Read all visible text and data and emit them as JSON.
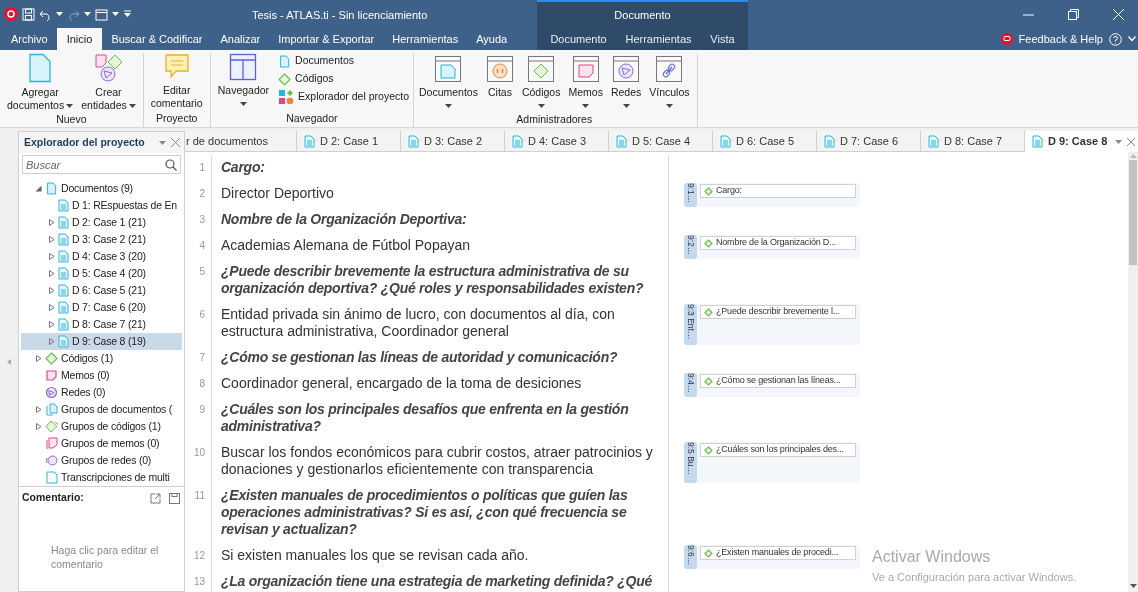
{
  "window": {
    "title": "Tesis - ATLAS.ti - Sin licenciamiento",
    "context_title": "Documento"
  },
  "menu_tabs": [
    {
      "label": "Archivo",
      "selected": false,
      "contextual": false
    },
    {
      "label": "Inicio",
      "selected": true,
      "contextual": false
    },
    {
      "label": "Buscar & Codificar",
      "selected": false,
      "contextual": false
    },
    {
      "label": "Analizar",
      "selected": false,
      "contextual": false
    },
    {
      "label": "Importar & Exportar",
      "selected": false,
      "contextual": false
    },
    {
      "label": "Herramientas",
      "selected": false,
      "contextual": false
    },
    {
      "label": "Ayuda",
      "selected": false,
      "contextual": false
    },
    {
      "label": "Documento",
      "selected": false,
      "contextual": true
    },
    {
      "label": "Herramientas",
      "selected": false,
      "contextual": true
    },
    {
      "label": "Vista",
      "selected": false,
      "contextual": true
    }
  ],
  "feedback": {
    "label": "Feedback & Help"
  },
  "ribbon": [
    {
      "group": "Nuevo",
      "buttons": [
        {
          "kind": "add-doc",
          "label": "Agregar",
          "label2": "documentos",
          "dropdown": true
        },
        {
          "kind": "create",
          "label": "Crear",
          "label2": "entidades",
          "dropdown": true
        }
      ]
    },
    {
      "group": "Proyecto",
      "buttons": [
        {
          "kind": "comment",
          "label": "Editar",
          "label2": "comentario",
          "dropdown": false
        }
      ]
    },
    {
      "group": "Navegador",
      "buttons": [
        {
          "kind": "navigator",
          "label": "Navegador",
          "dropdown": true
        }
      ],
      "small": [
        {
          "kind": "doc",
          "label": "Documentos"
        },
        {
          "kind": "code",
          "label": "Códigos"
        },
        {
          "kind": "explorer",
          "label": "Explorador del proyecto"
        }
      ]
    },
    {
      "group": "Administradores",
      "buttons": [
        {
          "kind": "mgr-doc",
          "label": "Documentos",
          "dropdown": true
        },
        {
          "kind": "mgr-quote",
          "label": "Citas",
          "dropdown": false
        },
        {
          "kind": "mgr-code",
          "label": "Códigos",
          "dropdown": true
        },
        {
          "kind": "mgr-memo",
          "label": "Memos",
          "dropdown": true
        },
        {
          "kind": "mgr-net",
          "label": "Redes",
          "dropdown": true
        },
        {
          "kind": "mgr-link",
          "label": "Vínculos",
          "dropdown": true
        }
      ]
    }
  ],
  "explorer": {
    "title": "Explorador del proyecto",
    "search_placeholder": "Buscar",
    "tree": [
      {
        "kind": "doc",
        "label": "Documentos (9)",
        "expanded": true,
        "selected": false,
        "children": [
          {
            "kind": "doc",
            "label": "D 1: REspuestas de En",
            "selected": false
          },
          {
            "kind": "doc",
            "label": "D 2: Case 1 (21)",
            "expanded": false,
            "selected": false
          },
          {
            "kind": "doc",
            "label": "D 3: Case 2 (21)",
            "expanded": false,
            "selected": false
          },
          {
            "kind": "doc",
            "label": "D 4: Case 3 (20)",
            "expanded": false,
            "selected": false
          },
          {
            "kind": "doc",
            "label": "D 5: Case 4 (20)",
            "expanded": false,
            "selected": false
          },
          {
            "kind": "doc",
            "label": "D 6: Case 5 (21)",
            "expanded": false,
            "selected": false
          },
          {
            "kind": "doc",
            "label": "D 7: Case 6 (20)",
            "expanded": false,
            "selected": false
          },
          {
            "kind": "doc",
            "label": "D 8: Case 7 (21)",
            "expanded": false,
            "selected": false
          },
          {
            "kind": "doc",
            "label": "D 9: Case 8 (19)",
            "expanded": false,
            "selected": true
          }
        ]
      },
      {
        "kind": "code",
        "label": "Códigos (1)",
        "expanded": false,
        "selected": false
      },
      {
        "kind": "memo",
        "label": "Memos (0)",
        "selected": false
      },
      {
        "kind": "net",
        "label": "Redes (0)",
        "selected": false
      },
      {
        "kind": "docgroup",
        "label": "Grupos de documentos (",
        "expanded": false,
        "selected": false
      },
      {
        "kind": "codegroup",
        "label": "Grupos de códigos (1)",
        "expanded": false,
        "selected": false
      },
      {
        "kind": "memogroup",
        "label": "Grupos de memos (0)",
        "selected": false
      },
      {
        "kind": "netgroup",
        "label": "Grupos de redes (0)",
        "selected": false
      },
      {
        "kind": "transcript",
        "label": "Transcripciones de multi",
        "selected": false
      }
    ]
  },
  "comment": {
    "title": "Comentario:",
    "placeholder": "Haga clic para editar el comentario"
  },
  "doc_tabs": [
    {
      "label": "r de documentos",
      "icon": false,
      "selected": false
    },
    {
      "label": "D 2: Case 1",
      "icon": true,
      "selected": false
    },
    {
      "label": "D 3: Case 2",
      "icon": true,
      "selected": false
    },
    {
      "label": "D 4: Case 3",
      "icon": true,
      "selected": false
    },
    {
      "label": "D 5: Case 4",
      "icon": true,
      "selected": false
    },
    {
      "label": "D 6: Case 5",
      "icon": true,
      "selected": false
    },
    {
      "label": "D 7: Case 6",
      "icon": true,
      "selected": false
    },
    {
      "label": "D 8: Case 7",
      "icon": true,
      "selected": false
    },
    {
      "label": "D 9: Case 8",
      "icon": true,
      "selected": true
    }
  ],
  "paragraphs": [
    {
      "number": "1",
      "kind": "question",
      "text": "Cargo:"
    },
    {
      "number": "2",
      "kind": "answer",
      "text": "Director Deportivo",
      "quote": {
        "id": "9:1…",
        "code": "Cargo:"
      }
    },
    {
      "number": "3",
      "kind": "question",
      "text": "Nombre de la Organización Deportiva:"
    },
    {
      "number": "4",
      "kind": "answer",
      "text": "Academias Alemana de Fútbol Popayan",
      "quote": {
        "id": "9:2…",
        "code": "Nombre de la Organización D..."
      }
    },
    {
      "number": "5",
      "kind": "question",
      "text": "¿Puede describir brevemente la estructura administrativa de su organización deportiva?  ¿Qué roles y responsabilidades existen?"
    },
    {
      "number": "6",
      "kind": "answer",
      "text": "Entidad privada sin ánimo de lucro, con documentos al día, con estructura administrativa,  Coordinador general",
      "quote": {
        "id": "9:3 Ent…",
        "code": "¿Puede describir brevemente l..."
      }
    },
    {
      "number": "7",
      "kind": "question",
      "text": "¿Cómo se gestionan las líneas de autoridad y comunicación?"
    },
    {
      "number": "8",
      "kind": "answer",
      "text": "Coordinador general, encargado de la toma de desiciones",
      "quote": {
        "id": "9:4…",
        "code": "¿Cómo se gestionan las líneas..."
      }
    },
    {
      "number": "9",
      "kind": "question",
      "text": "¿Cuáles son los principales desafíos que enfrenta en la gestión administrativa?"
    },
    {
      "number": "10",
      "kind": "answer",
      "text": "Buscar los fondos económicos para cubrir costos, atraer patrocinios y donaciones y gestionarlos eficientemente con transparencia",
      "quote": {
        "id": "9:5 Bu…",
        "code": "¿Cuáles son los principales des..."
      }
    },
    {
      "number": "11",
      "kind": "question",
      "text": "¿Existen manuales de procedimientos o políticas que guíen las operaciones administrativas? Si es así, ¿con qué frecuencia se revisan y actualizan?"
    },
    {
      "number": "12",
      "kind": "answer",
      "text": "Si existen manuales los que se revisan cada año.",
      "quote": {
        "id": "9:6…",
        "code": "¿Existen manuales de procedi..."
      }
    },
    {
      "number": "13",
      "kind": "question",
      "text": "¿La organización tiene una estrategia de marketing definida? ¿Qué"
    }
  ],
  "activation": {
    "title": "Activar Windows",
    "subtitle": "Ve a Configuración para activar Windows."
  }
}
